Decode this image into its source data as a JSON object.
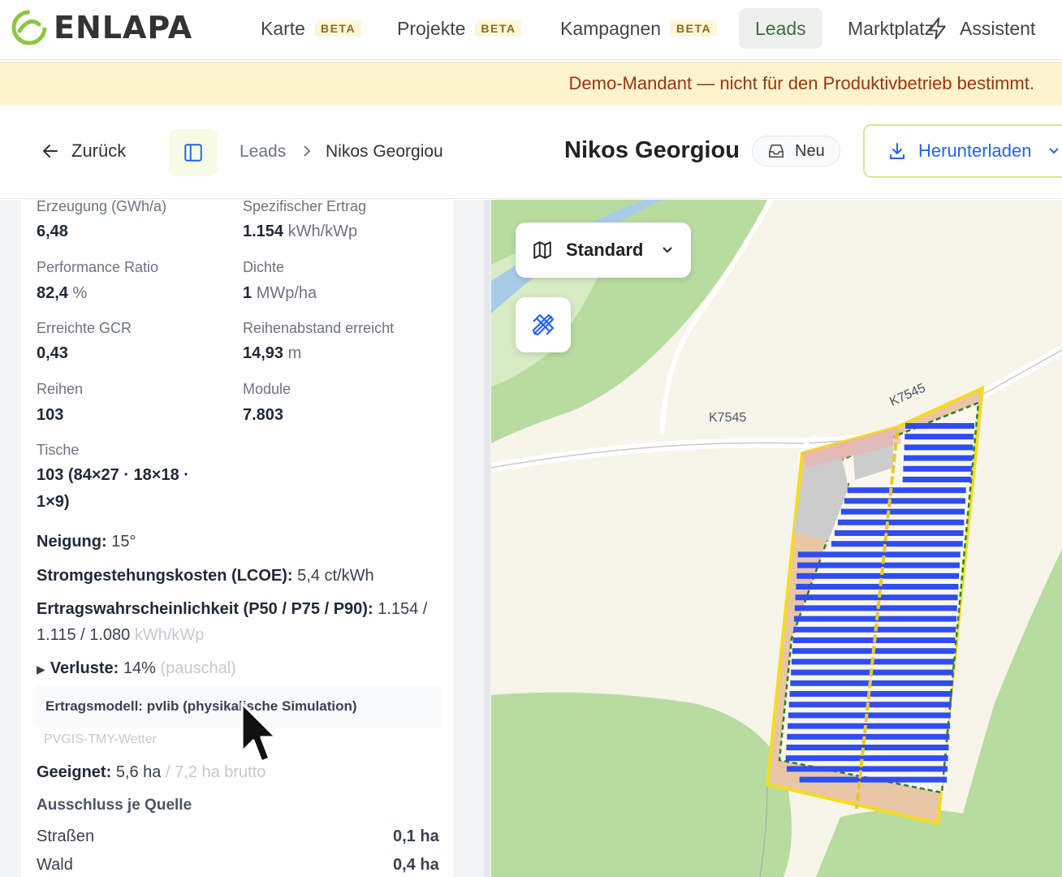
{
  "app": {
    "name": "ENLAPA"
  },
  "nav": {
    "items": [
      {
        "label": "Karte",
        "badge": "BETA"
      },
      {
        "label": "Projekte",
        "badge": "BETA"
      },
      {
        "label": "Kampagnen",
        "badge": "BETA"
      },
      {
        "label": "Leads",
        "active": true
      },
      {
        "label": "Marktplatz"
      },
      {
        "label": "Assistent"
      }
    ]
  },
  "banner": {
    "text": "Demo-Mandant — nicht für den Produktivbetrieb bestimmt."
  },
  "header": {
    "back_label": "Zurück",
    "breadcrumb": [
      "Leads",
      "Nikos Georgiou"
    ],
    "title": "Nikos Georgiou",
    "status": "Neu",
    "download_label": "Herunterladen"
  },
  "metrics": {
    "erzeugung": {
      "label": "Erzeugung (GWh/a)",
      "value": "6,48"
    },
    "ertrag": {
      "label": "Spezifischer Ertrag",
      "value": "1.154",
      "unit": "kWh/kWp"
    },
    "pr": {
      "label": "Performance Ratio",
      "value": "82,4",
      "unit": "%"
    },
    "dichte": {
      "label": "Dichte",
      "value": "1",
      "unit": "MWp/ha"
    },
    "gcr": {
      "label": "Erreichte GCR",
      "value": "0,43"
    },
    "reihenabstand": {
      "label": "Reihenabstand erreicht",
      "value": "14,93",
      "unit": "m"
    },
    "reihen": {
      "label": "Reihen",
      "value": "103"
    },
    "module": {
      "label": "Module",
      "value": "7.803"
    },
    "tische": {
      "label": "Tische",
      "line1": "103 (84×27 · 18×18 ·",
      "line2": "1×9)"
    }
  },
  "details": {
    "neigung_label": "Neigung:",
    "neigung_value": "15°",
    "lcoe_label": "Stromgestehungskosten (LCOE):",
    "lcoe_value": "5,4 ct/kWh",
    "p_label": "Ertragswahrscheinlichkeit (P50 / P75 / P90):",
    "p_value1": "1.154 /",
    "p_value2": "1.115 / 1.080",
    "p_unit": "kWh/kWp",
    "verluste_label": "Verluste:",
    "verluste_value": "14%",
    "verluste_note": "(pauschal)",
    "model": "Ertragsmodell: pvlib (physikalische Simulation)",
    "weather": "PVGIS-TMY-Wetter",
    "geeignet_label": "Geeignet:",
    "geeignet_value": "5,6 ha",
    "geeignet_note": "/ 7,2 ha brutto",
    "ausschluss_title": "Ausschluss je Quelle",
    "ausschluss": [
      {
        "label": "Straßen",
        "value": "0,1 ha"
      },
      {
        "label": "Wald",
        "value": "0,4 ha"
      }
    ]
  },
  "map": {
    "layer_label": "Standard",
    "road_labels": [
      "K7545",
      "K7545"
    ]
  },
  "colors": {
    "accent": "#2563eb",
    "brand_green": "#8cc63f",
    "banner": "#fdf3cc",
    "panel_rows": "#2f4df0"
  }
}
